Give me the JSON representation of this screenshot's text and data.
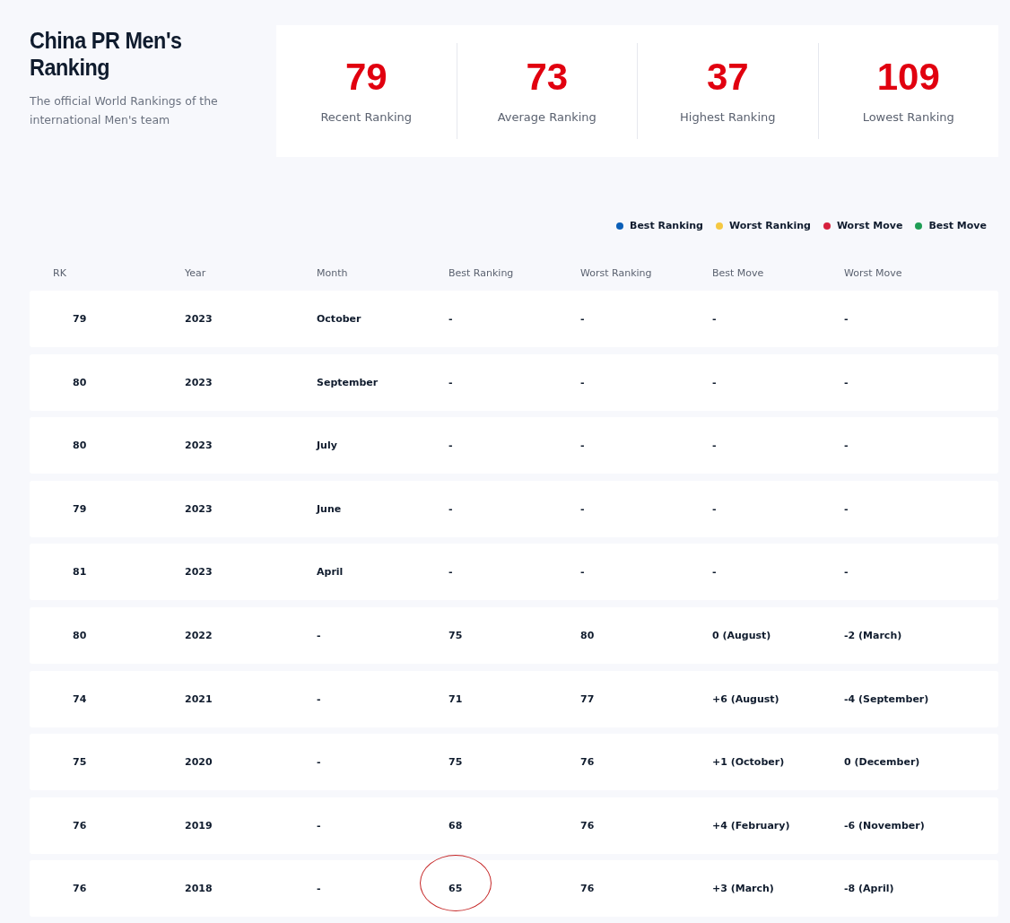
{
  "header": {
    "title": "China PR Men's Ranking",
    "subtitle": "The official World Rankings of the international Men's team"
  },
  "stats": [
    {
      "value": "79",
      "label": "Recent Ranking"
    },
    {
      "value": "73",
      "label": "Average Ranking"
    },
    {
      "value": "37",
      "label": "Highest Ranking"
    },
    {
      "value": "109",
      "label": "Lowest Ranking"
    }
  ],
  "legend": [
    {
      "label": "Best Ranking",
      "color": "#0b5fb8"
    },
    {
      "label": "Worst Ranking",
      "color": "#f5c842"
    },
    {
      "label": "Worst Move",
      "color": "#d6203d"
    },
    {
      "label": "Best Move",
      "color": "#1f9d55"
    }
  ],
  "table": {
    "columns": [
      "RK",
      "Year",
      "Month",
      "Best Ranking",
      "Worst Ranking",
      "Best Move",
      "Worst Move"
    ],
    "rows": [
      {
        "cells": [
          "79",
          "2023",
          "October",
          "-",
          "-",
          "-",
          "-"
        ],
        "best_circled": false
      },
      {
        "cells": [
          "80",
          "2023",
          "September",
          "-",
          "-",
          "-",
          "-"
        ],
        "best_circled": false
      },
      {
        "cells": [
          "80",
          "2023",
          "July",
          "-",
          "-",
          "-",
          "-"
        ],
        "best_circled": false
      },
      {
        "cells": [
          "79",
          "2023",
          "June",
          "-",
          "-",
          "-",
          "-"
        ],
        "best_circled": false
      },
      {
        "cells": [
          "81",
          "2023",
          "April",
          "-",
          "-",
          "-",
          "-"
        ],
        "best_circled": false
      },
      {
        "cells": [
          "80",
          "2022",
          "-",
          "75",
          "80",
          "0 (August)",
          "-2 (March)"
        ],
        "best_circled": false
      },
      {
        "cells": [
          "74",
          "2021",
          "-",
          "71",
          "77",
          "+6 (August)",
          "-4 (September)"
        ],
        "best_circled": false
      },
      {
        "cells": [
          "75",
          "2020",
          "-",
          "75",
          "76",
          "+1 (October)",
          "0 (December)"
        ],
        "best_circled": false
      },
      {
        "cells": [
          "76",
          "2019",
          "-",
          "68",
          "76",
          "+4 (February)",
          "-6 (November)"
        ],
        "best_circled": false
      },
      {
        "cells": [
          "76",
          "2018",
          "-",
          "65",
          "76",
          "+3 (March)",
          "-8 (April)"
        ],
        "best_circled": true
      }
    ]
  }
}
